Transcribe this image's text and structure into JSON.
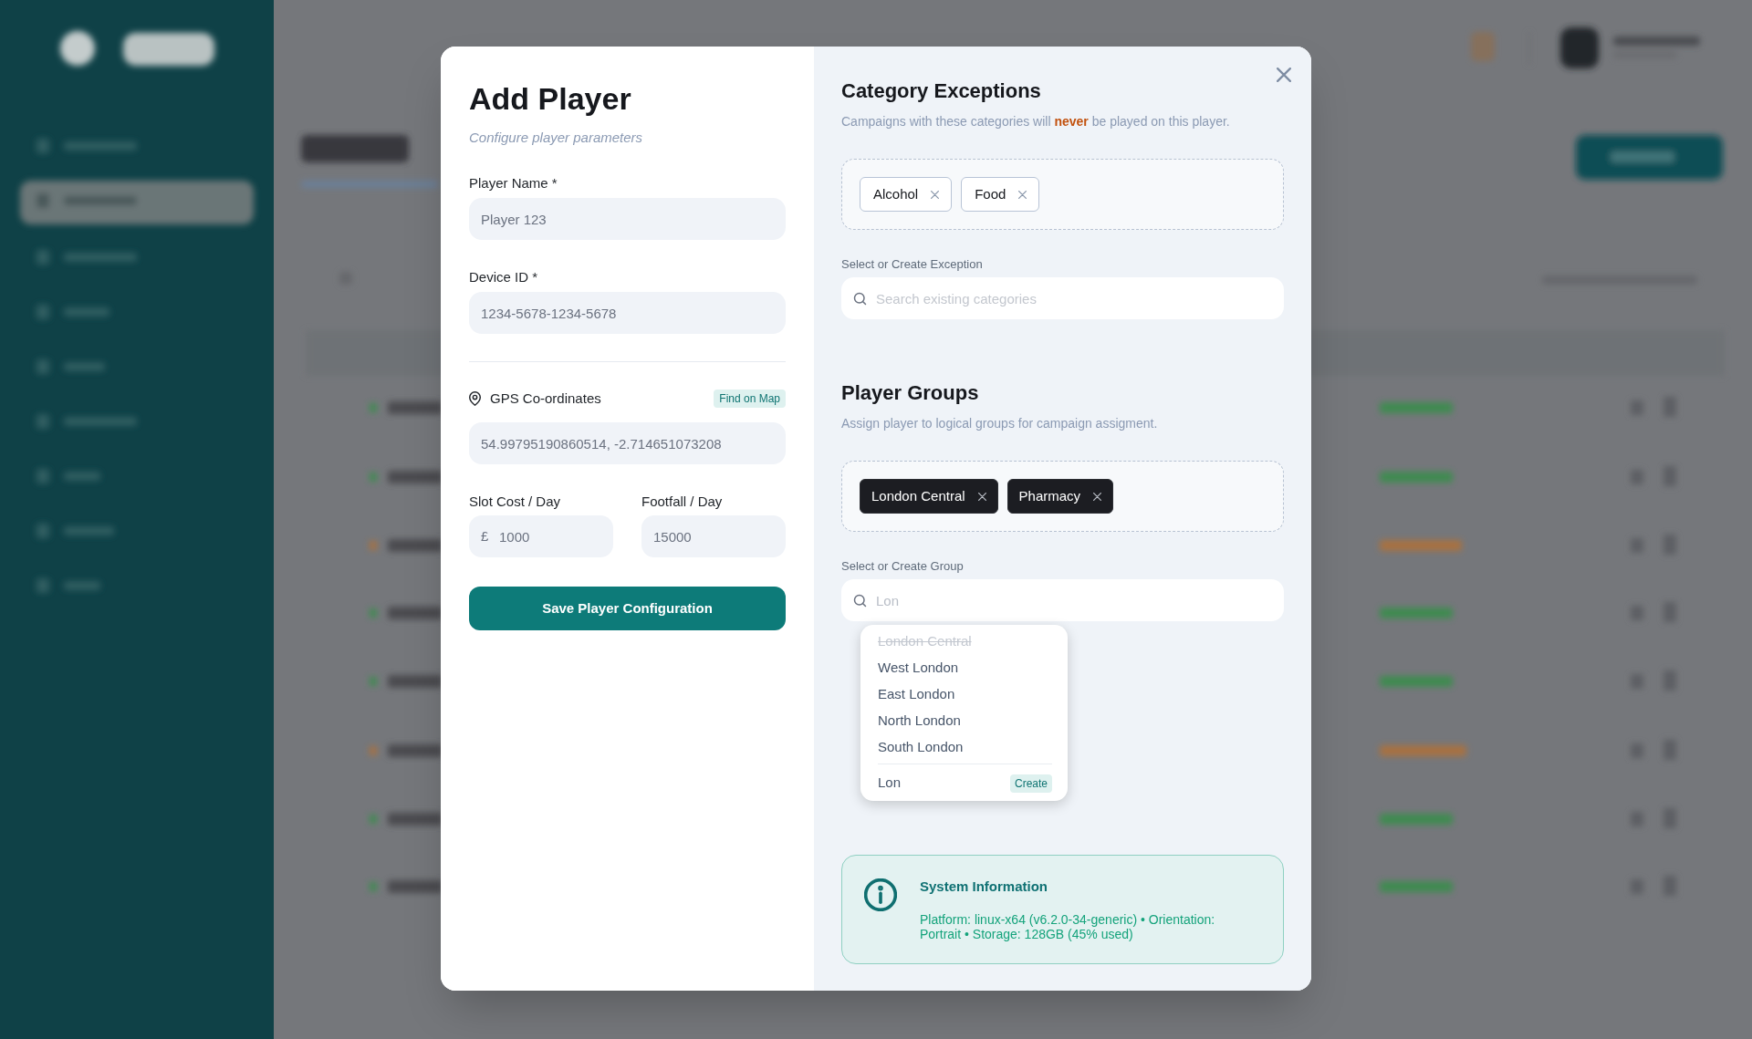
{
  "dialog": {
    "title": "Add Player",
    "subtitle": "Configure player parameters",
    "fields": [
      {
        "kind": "text",
        "label": "Player Name *",
        "value": "Player 123"
      },
      {
        "kind": "text",
        "label": "Device ID *",
        "value": "1234-5678-1234-5678"
      },
      {
        "kind": "gps",
        "label": "GPS Co-ordinates",
        "action": "Find on Map",
        "value": "54.99795190860514, -2.714651073208"
      }
    ],
    "pair_fields": [
      {
        "label": "Slot Cost / Day",
        "prefix": "£",
        "value": "1000"
      },
      {
        "label": "Footfall / Day",
        "value": "15000"
      }
    ],
    "save_button": "Save Player Configuration",
    "sections": [
      {
        "kind": "exceptions",
        "title": "Category Exceptions",
        "description": "Campaigns with these categories will **never** be played on this player.",
        "tags": [
          {
            "label": "Alcohol"
          },
          {
            "label": "Food"
          }
        ],
        "search_label": "Select or Create Exception",
        "search": {
          "placeholder": "Search existing categories"
        }
      },
      {
        "kind": "groups",
        "title": "Player Groups",
        "description": "Assign player to logical groups for campaign assigment.",
        "tags": [
          {
            "label": "London Central"
          },
          {
            "label": "Pharmacy"
          }
        ],
        "search_label": "Select or Create Group",
        "search": {
          "value": "Lon"
        },
        "dropdown": {
          "options": [
            {
              "label": "London Central",
              "disabled": true
            },
            {
              "label": "West London",
              "disabled": false
            },
            {
              "label": "East London",
              "disabled": false
            },
            {
              "label": "North London",
              "disabled": false
            },
            {
              "label": "South London",
              "disabled": false
            }
          ],
          "create": {
            "label": "Lon",
            "button": "Create"
          }
        }
      }
    ],
    "info": {
      "title": "System Information",
      "text": "Platform: linux-x64 (v6.2.0-34-generic) • Orientation: Portrait • Storage: 128GB (45% used)"
    }
  }
}
